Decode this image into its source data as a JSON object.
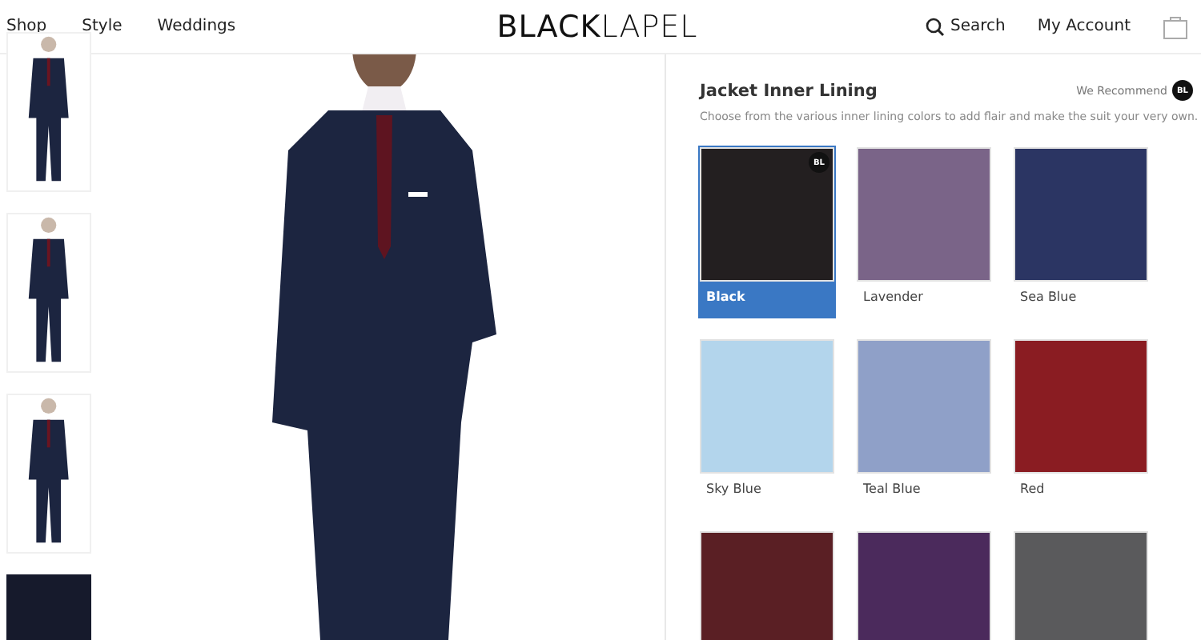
{
  "nav": {
    "links": [
      "Shop",
      "Style",
      "Weddings"
    ],
    "logo": "**BLACK**LAPEL",
    "search": "Search",
    "account": "My Account"
  },
  "gallery": {
    "thumbnails": [
      {
        "kind": "figure"
      },
      {
        "kind": "figure"
      },
      {
        "kind": "figure"
      },
      {
        "kind": "fabric"
      }
    ]
  },
  "options": {
    "title": "Jacket Inner Lining",
    "recommend_label": "We Recommend",
    "recommend_badge": "BL",
    "description": "Choose from the various inner lining colors to add flair and make the suit your very own.",
    "swatches": [
      {
        "name": "Black",
        "color": "#231f20",
        "selected": true,
        "badge": "BL"
      },
      {
        "name": "Lavender",
        "color": "#7a6488",
        "selected": false
      },
      {
        "name": "Sea Blue",
        "color": "#2b3563",
        "selected": false
      },
      {
        "name": "Sky Blue",
        "color": "#b3d5ec",
        "selected": false
      },
      {
        "name": "Teal Blue",
        "color": "#8fa0c8",
        "selected": false
      },
      {
        "name": "Red",
        "color": "#8a1c22",
        "selected": false
      },
      {
        "color": "#5a1f24",
        "selected": false
      },
      {
        "color": "#4b2a5c",
        "selected": false
      },
      {
        "color": "#5a5a5c",
        "selected": false
      }
    ]
  }
}
